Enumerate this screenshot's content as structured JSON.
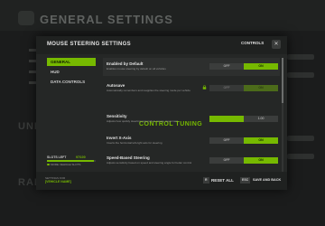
{
  "background": {
    "title": "GENERAL SETTINGS",
    "section_1": "UNIT",
    "section_2": "RAD"
  },
  "modal": {
    "title": "MOUSE STEERING SETTINGS",
    "controls_label": "CONTROLS",
    "sidebar": [
      {
        "label": "GENERAL",
        "active": true
      },
      {
        "label": "HUD",
        "active": false
      },
      {
        "label": "DATA CONTROLS",
        "active": false
      }
    ],
    "settings": [
      {
        "title": "Enabled by Default",
        "desc": "Enables mouse steering by default on all vehicles",
        "off": "OFF",
        "on": "ON",
        "state": "on"
      },
      {
        "title": "Autosave",
        "desc": "Automatically remembers and reapplies the steering mode per vehicle",
        "off": "OFF",
        "on": "ON",
        "state": "on-disabled"
      }
    ],
    "section_header": "CONTROL TUNING",
    "tuning": [
      {
        "title": "Sensitivity",
        "desc": "Adjusts how quickly steering responds to mouse movement",
        "value_text": "1.00",
        "fill_fraction": 0.5
      },
      {
        "title": "Invert X-Axis",
        "desc": "Inverts the horizontal left-right axis for steering",
        "off": "OFF",
        "on": "ON",
        "state": "on"
      },
      {
        "title": "Speed-Based Steering",
        "desc": "Adjusts sensitivity based on speed and steering angle for better control",
        "off": "OFF",
        "on": "ON",
        "state": "on"
      }
    ],
    "slots": {
      "label": "SLOTS LEFT",
      "value": "97/100",
      "legend": "MORE VEHICLE SLOTS",
      "used_fraction": 0.97
    },
    "footer": {
      "label": "SETTINGS FOR",
      "name": "[VEHICLE NAME]",
      "reset_key": "R",
      "reset_label": "RESET ALL",
      "save_key": "ESC",
      "save_label": "SAVE AND BACK"
    },
    "colors": {
      "accent": "#76b900",
      "panel": "#252726"
    }
  }
}
